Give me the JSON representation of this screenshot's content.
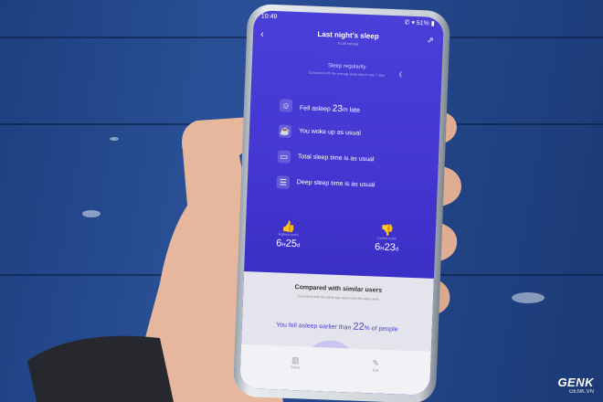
{
  "status": {
    "time": "10:49",
    "icons": "✆ ▾ 51% ▮"
  },
  "app": {
    "title": "Last night's sleep",
    "subtitle": "To all normal"
  },
  "regularity": {
    "title": "Sleep regularity",
    "subtitle": "Compared with the average sleep data in last 7 days",
    "items": [
      {
        "pre": "Fell asleep ",
        "big": "23",
        "post": "m late"
      },
      {
        "pre": "You woke up as usual",
        "big": "",
        "post": ""
      },
      {
        "pre": "Total sleep time is as usual",
        "big": "",
        "post": ""
      },
      {
        "pre": "Deep sleep time is as usual",
        "big": "",
        "post": ""
      }
    ]
  },
  "stats": {
    "highest": {
      "label": "Highest score",
      "h": "6",
      "m": "25",
      "unit_h": "H",
      "unit_m": "d"
    },
    "lowest": {
      "label": "Lowest score",
      "h": "6",
      "m": "23",
      "unit_h": "H",
      "unit_m": "d"
    }
  },
  "compare": {
    "title": "Compared with similar users",
    "subtitle": "Compared with the same age users from the same area",
    "line_pre": "You fell asleep earlier than ",
    "line_big": "22",
    "line_post": "% of people"
  },
  "tabs": [
    {
      "label": "Status"
    },
    {
      "label": "Edit"
    }
  ],
  "watermark": {
    "brand": "GENK",
    "site": "GENK.VN"
  },
  "icons": {
    "back": "back-arrow-icon",
    "share": "share-icon",
    "moon": "moon-icon",
    "row1": "alarm-face-icon",
    "row2": "cup-icon",
    "row3": "bed-icon",
    "row4": "sleep-icon",
    "thumb_up": "thumb-up-icon",
    "thumb_down": "thumb-down-icon"
  },
  "colors": {
    "screen_accent": "#4a3fd9",
    "background_wood": "#24478a"
  }
}
